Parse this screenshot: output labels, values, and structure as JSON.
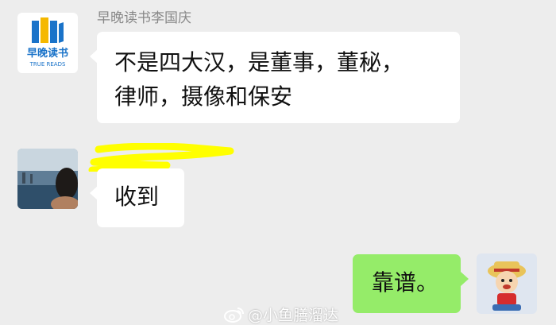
{
  "chat": {
    "sender_name": "早晚读书李国庆",
    "messages": [
      {
        "direction": "incoming",
        "sender": "brand",
        "text": "不是四大汉，是董事，董秘，律师，摄像和保安",
        "lines": [
          "不是四大汉，是董事，董秘，",
          "律师，摄像和保安"
        ]
      },
      {
        "direction": "incoming",
        "sender": "redacted-user",
        "text": "收到"
      },
      {
        "direction": "outgoing",
        "sender": "self",
        "text": "靠谱。"
      }
    ]
  },
  "logo": {
    "brand_text": "早晚读书",
    "brand_subtext": "TRUE READS"
  },
  "watermark": {
    "text": "@小鱼膳溜达"
  },
  "colors": {
    "background": "#ededed",
    "incoming_bubble": "#ffffff",
    "outgoing_bubble": "#95ec69",
    "redaction_highlight": "#ffff00",
    "logo_blue": "#1a73c9",
    "logo_yellow": "#f5b800"
  },
  "icons": [
    "brand-logo-icon",
    "weibo-icon"
  ]
}
